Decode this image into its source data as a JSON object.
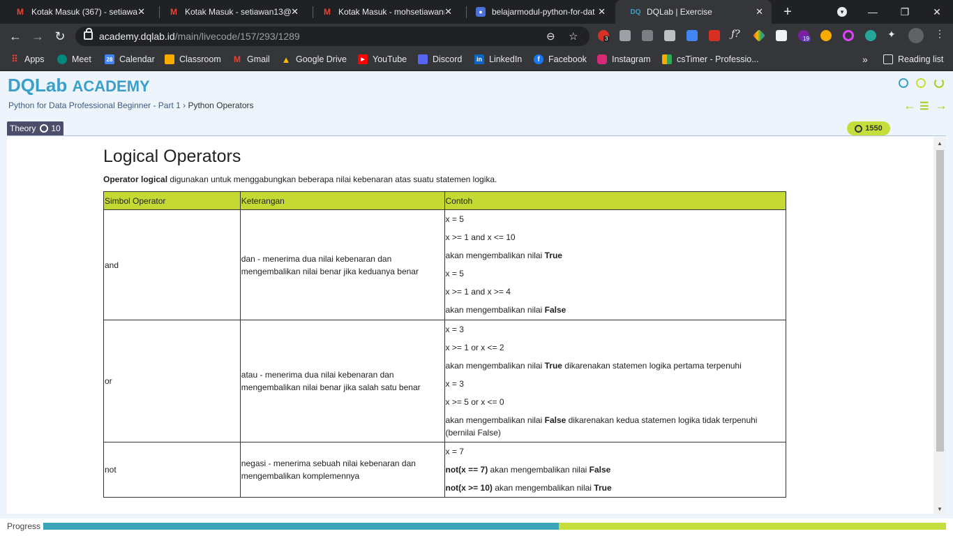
{
  "browser": {
    "tabs": [
      {
        "title": "Kotak Masuk (367) - setiawan",
        "icon": "gmail-icon"
      },
      {
        "title": "Kotak Masuk - setiawan13@",
        "icon": "gmail-icon"
      },
      {
        "title": "Kotak Masuk - mohsetiawann",
        "icon": "gmail-icon"
      },
      {
        "title": "belajarmodul-python-for-dat",
        "icon": "classroom-icon"
      },
      {
        "title": "DQLab | Exercise",
        "icon": "dqlab-icon"
      }
    ],
    "new_tab": "+",
    "url_host": "academy.dqlab.id",
    "url_path": "/main/livecode/157/293/1289",
    "extension_badges": {
      "first": "3",
      "second": "19"
    },
    "bookmarks": [
      "Apps",
      "Meet",
      "Calendar",
      "Classroom",
      "Gmail",
      "Google Drive",
      "YouTube",
      "Discord",
      "LinkedIn",
      "Facebook",
      "Instagram",
      "csTimer - Professio..."
    ],
    "bookmarks_more": "»",
    "reading_list": "Reading list"
  },
  "site": {
    "logo_main": "DQLab",
    "logo_sub": "ACADEMY",
    "breadcrumb_course": "Python for Data Professional Beginner - Part 1",
    "breadcrumb_sep": " › ",
    "breadcrumb_current": "Python Operators",
    "theory_label": "Theory",
    "theory_count": "10",
    "points": "1550",
    "progress_label": "Progress",
    "progress_fraction": 0.571
  },
  "lesson": {
    "title": "Logical Operators",
    "intro_bold": "Operator logical",
    "intro_rest": " digunakan untuk menggabungkan beberapa nilai kebenaran atas suatu statemen logika.",
    "headers": [
      "Simbol Operator",
      "Keterangan",
      "Contoh"
    ],
    "rows": [
      {
        "symbol": "and",
        "desc": "dan - menerima dua nilai kebenaran dan mengembalikan nilai benar jika keduanya benar",
        "ex": [
          "x = 5",
          "x >= 1 and x <= 10",
          "akan mengembalikan nilai ",
          "True",
          "x = 5",
          "x >= 1 and x >= 4",
          "akan mengembalikan nilai ",
          "False"
        ]
      },
      {
        "symbol": "or",
        "desc": "atau - menerima dua nilai kebenaran dan mengembalikan nilai benar jika salah satu benar",
        "ex": [
          "x = 3",
          "x >= 1 or x <= 2",
          "akan mengembalikan nilai ",
          "True",
          " dikarenakan statemen logika pertama terpenuhi",
          "x = 3",
          "x >= 5 or x <= 0",
          "akan mengembalikan nilai ",
          "False",
          " dikarenakan kedua statemen logika tidak terpenuhi (bernilai False)"
        ]
      },
      {
        "symbol": "not",
        "desc": "negasi - menerima sebuah nilai kebenaran dan mengembalikan komplemennya",
        "ex": [
          "x = 7",
          "not(x == 7)",
          " akan mengembalikan nilai ",
          "False",
          "not(x >= 10)",
          " akan mengembalikan nilai ",
          "True"
        ]
      }
    ]
  },
  "colors": {
    "accent_green": "#c5de3b",
    "accent_teal": "#3aa5b9",
    "chrome_dark": "#202124"
  }
}
